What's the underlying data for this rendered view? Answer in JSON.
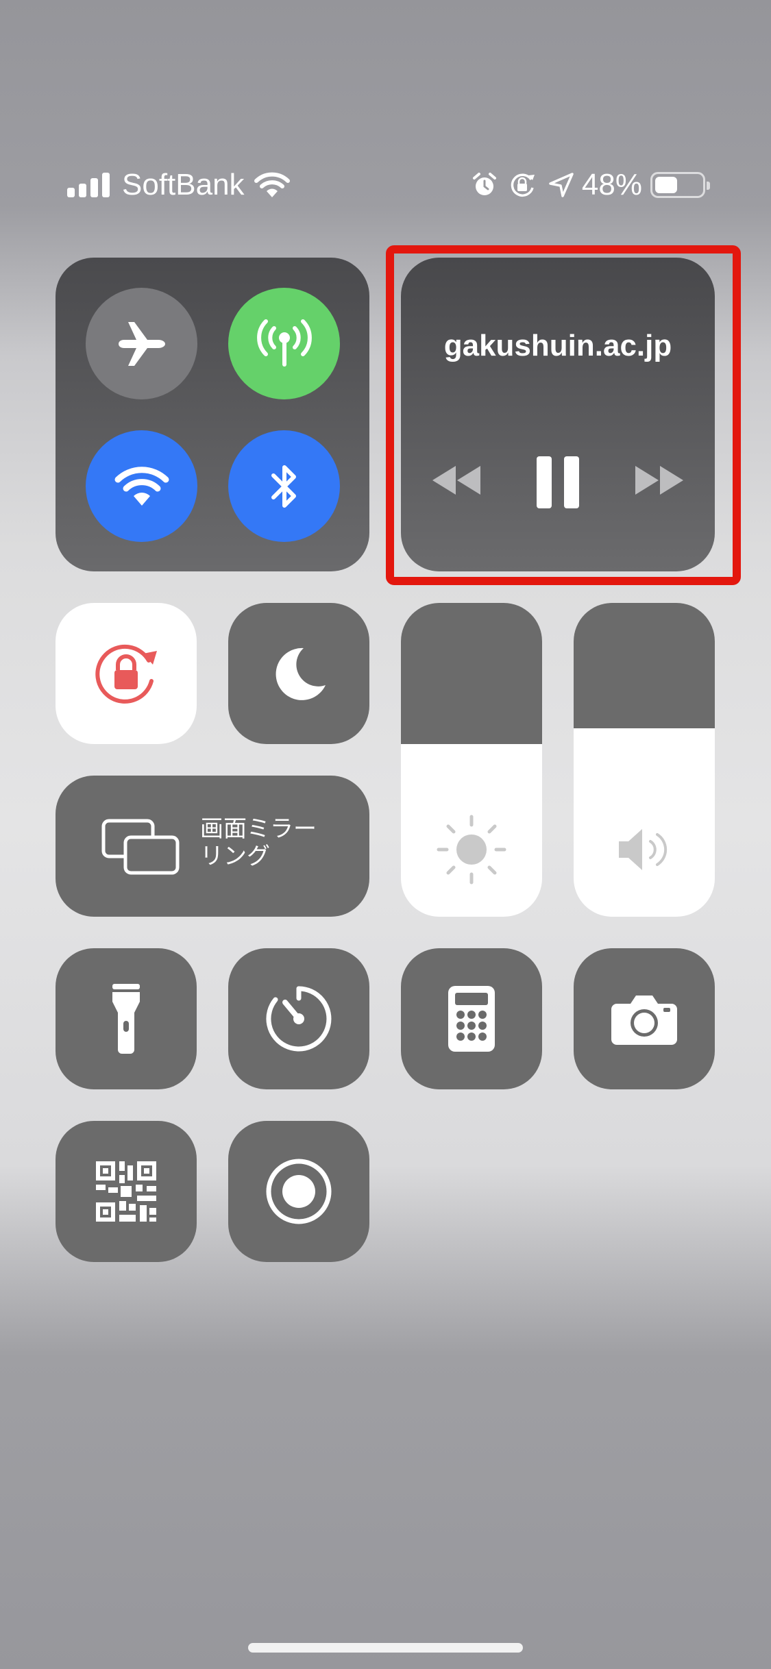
{
  "status_bar": {
    "carrier": "SoftBank",
    "battery_percent": "48%",
    "battery_level": 0.48,
    "icons": [
      "signal-icon",
      "wifi-icon",
      "alarm-icon",
      "orientation-lock-icon",
      "location-icon",
      "battery-icon"
    ]
  },
  "connectivity": {
    "airplane": {
      "icon": "airplane-icon",
      "state": "off"
    },
    "cellular": {
      "icon": "cellular-antenna-icon",
      "state": "on",
      "color": "#65d16a"
    },
    "wifi": {
      "icon": "wifi-icon",
      "state": "on",
      "color": "#3478f6"
    },
    "bluetooth": {
      "icon": "bluetooth-icon",
      "state": "on",
      "color": "#3478f6"
    }
  },
  "music": {
    "title": "gakushuin.ac.jp",
    "controls": [
      "rewind-icon",
      "pause-icon",
      "fast-forward-icon"
    ]
  },
  "highlight_color": "#e3170e",
  "orientation_lock": {
    "icon": "orientation-lock-icon",
    "state": "on",
    "color": "#e85a5a"
  },
  "do_not_disturb": {
    "icon": "moon-icon",
    "state": "off"
  },
  "screen_mirroring": {
    "icon": "screen-mirroring-icon",
    "label_line1": "画面ミラー",
    "label_line2": "リング"
  },
  "brightness": {
    "icon": "brightness-icon",
    "level": 0.55
  },
  "volume": {
    "icon": "speaker-icon",
    "level": 0.6
  },
  "shortcuts": [
    {
      "name": "flashlight",
      "icon": "flashlight-icon"
    },
    {
      "name": "timer",
      "icon": "timer-icon"
    },
    {
      "name": "calculator",
      "icon": "calculator-icon"
    },
    {
      "name": "camera",
      "icon": "camera-icon"
    },
    {
      "name": "qr-scanner",
      "icon": "qr-code-icon"
    },
    {
      "name": "screen-recording",
      "icon": "record-icon"
    }
  ]
}
